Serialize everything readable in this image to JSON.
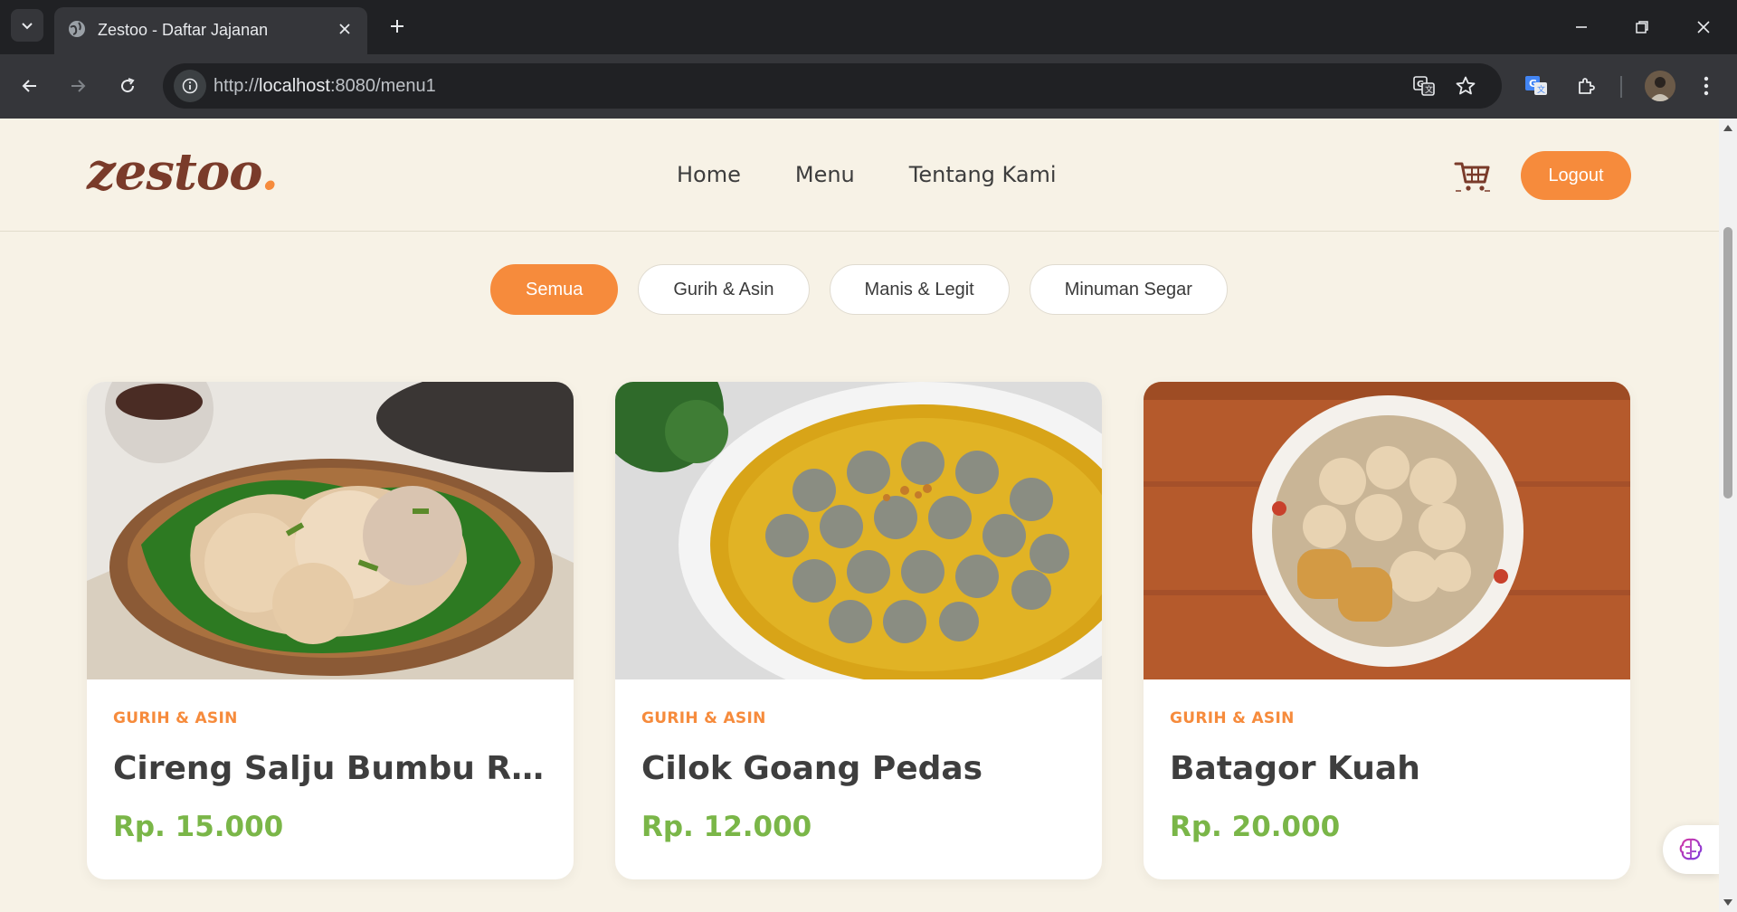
{
  "browser": {
    "tab_title": "Zestoo - Daftar Jajanan",
    "url_prefix": "http://",
    "url_host": "localhost",
    "url_rest": ":8080/menu1"
  },
  "site": {
    "logo_text": "zestoo",
    "logo_dot": ".",
    "nav": [
      "Home",
      "Menu",
      "Tentang Kami"
    ],
    "logout_label": "Logout"
  },
  "filters": [
    {
      "label": "Semua",
      "active": true
    },
    {
      "label": "Gurih & Asin",
      "active": false
    },
    {
      "label": "Manis & Legit",
      "active": false
    },
    {
      "label": "Minuman Segar",
      "active": false
    }
  ],
  "cards": [
    {
      "category": "GURIH & ASIN",
      "name": "Cireng Salju Bumbu Rujak",
      "price": "Rp. 15.000"
    },
    {
      "category": "GURIH & ASIN",
      "name": "Cilok Goang Pedas",
      "price": "Rp. 12.000"
    },
    {
      "category": "GURIH & ASIN",
      "name": "Batagor Kuah",
      "price": "Rp. 20.000"
    }
  ],
  "colors": {
    "accent": "#f68b3c",
    "brand_brown": "#7a3b2a",
    "price_green": "#7ab648",
    "page_bg": "#f7f2e6"
  }
}
